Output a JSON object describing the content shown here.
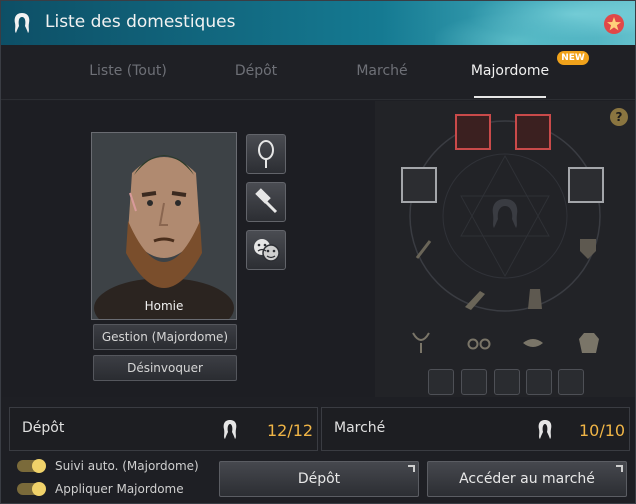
{
  "window": {
    "title": "Liste des domestiques"
  },
  "tabs": [
    {
      "label": "Liste (Tout)",
      "active": false
    },
    {
      "label": "Dépôt",
      "active": false
    },
    {
      "label": "Marché",
      "active": false
    },
    {
      "label": "Majordome",
      "active": true
    }
  ],
  "new_badge": "NEW",
  "character": {
    "name": "Homie"
  },
  "character_buttons": {
    "manage": "Gestion (Majordome)",
    "unsummon": "Désinvoquer"
  },
  "help_label": "?",
  "storage": {
    "label": "Dépôt",
    "value": "12/12"
  },
  "market": {
    "label": "Marché",
    "value": "10/10"
  },
  "toggles": [
    {
      "label": "Suivi auto. (Majordome)",
      "on": true
    },
    {
      "label": "Appliquer Majordome",
      "on": true
    }
  ],
  "actions": {
    "storage_button": "Dépôt",
    "market_button": "Accéder au marché"
  },
  "colors": {
    "accent": "#f0b546",
    "badge": "#f0a21b",
    "equip_red": "#c94a4a",
    "titlebar": "#157a92"
  }
}
